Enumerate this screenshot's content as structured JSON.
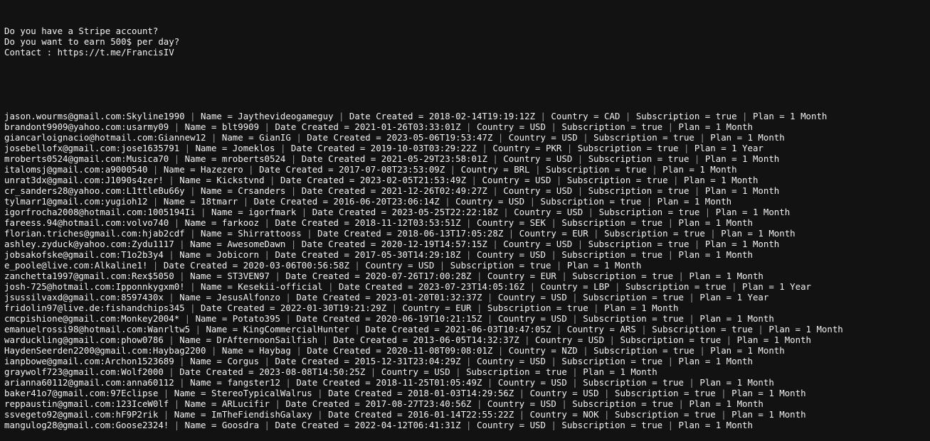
{
  "terminal": {
    "background_color": "#121212",
    "text_color": "#f2f2f2",
    "separator_color": "#9a9a9a",
    "banner": [
      "Do you have a Stripe account?",
      "Do you want to earn 500$ per day?",
      "Contact : https://t.me/FrancisIV"
    ],
    "field_labels": {
      "name": "Name",
      "date_created": "Date Created",
      "country": "Country",
      "subscription": "Subscription",
      "plan": "Plan"
    },
    "separator": "|",
    "equals": "=",
    "records": [
      {
        "credentials": "jason.wourms@gmail.com:Skyline1990",
        "name": "Jaythevideogameguy",
        "date_created": "2018-02-14T19:19:12Z",
        "country": "CAD",
        "subscription": "true",
        "plan": "1 Month"
      },
      {
        "credentials": "brandont9909@yahoo.com:usarmy09",
        "name": "blt9909",
        "date_created": "2021-01-26T03:33:01Z",
        "country": "USD",
        "subscription": "true",
        "plan": "1 Month"
      },
      {
        "credentials": "giancarloignacio@hotmail.com:Giannew12",
        "name": "GianIG",
        "date_created": "2023-05-06T19:53:47Z",
        "country": "USD",
        "subscription": "true",
        "plan": "1 Month"
      },
      {
        "credentials": "josebellofx@gmail.com:jose1635791",
        "name": "Jomeklos",
        "date_created": "2019-10-03T03:29:22Z",
        "country": "PKR",
        "subscription": "true",
        "plan": "1 Year"
      },
      {
        "credentials": "mroberts0524@gmail.com:Musica70",
        "name": "mroberts0524",
        "date_created": "2021-05-29T23:58:01Z",
        "country": "USD",
        "subscription": "true",
        "plan": "1 Month"
      },
      {
        "credentials": "italomsj@gmail.com:a9000540",
        "name": "Hazezero",
        "date_created": "2017-07-08T23:53:09Z",
        "country": "BRL",
        "subscription": "true",
        "plan": "1 Month"
      },
      {
        "credentials": "unrat3dx@gmail.com:J1090s4zer!",
        "name": "Kickstvnd",
        "date_created": "2023-02-05T21:53:49Z",
        "country": "USD",
        "subscription": "true",
        "plan": "1 Month"
      },
      {
        "credentials": "cr_sanders28@yahoo.com:L1ttleBu66y",
        "name": "Crsanders",
        "date_created": "2021-12-26T02:49:27Z",
        "country": "USD",
        "subscription": "true",
        "plan": "1 Month"
      },
      {
        "credentials": "tylmarr1@gmail.com:yugioh12",
        "name": "18tmarr",
        "date_created": "2016-06-20T23:06:14Z",
        "country": "USD",
        "subscription": "true",
        "plan": "1 Month"
      },
      {
        "credentials": "igorfrocha2008@hotmail.com:1005194Ii",
        "name": "igorfmark",
        "date_created": "2023-05-25T22:22:18Z",
        "country": "USD",
        "subscription": "true",
        "plan": "1 Month"
      },
      {
        "credentials": "fareess.94@hotmail.com:volvo740",
        "name": "farkooz",
        "date_created": "2018-11-12T03:53:51Z",
        "country": "SEK",
        "subscription": "true",
        "plan": "1 Month"
      },
      {
        "credentials": "florian.triches@gmail.com:hjab2cdf",
        "name": "Shirrattooss",
        "date_created": "2018-06-13T17:05:28Z",
        "country": "EUR",
        "subscription": "true",
        "plan": "1 Month"
      },
      {
        "credentials": "ashley.zyduck@yahoo.com:Zydu1117",
        "name": "AwesomeDawn",
        "date_created": "2020-12-19T14:57:15Z",
        "country": "USD",
        "subscription": "true",
        "plan": "1 Month"
      },
      {
        "credentials": "jobsakofske@gmail.com:T1o2b3y4",
        "name": "Jobicorn",
        "date_created": "2017-05-30T14:29:18Z",
        "country": "USD",
        "subscription": "true",
        "plan": "1 Month"
      },
      {
        "credentials": "e_poole@live.com:Alkaline1!",
        "name": null,
        "date_created": "2020-03-06T00:56:58Z",
        "country": "USD",
        "subscription": "true",
        "plan": "1 Month"
      },
      {
        "credentials": "zanchetta1997@gmail.com:Rex$5050",
        "name": "ST3VEN97",
        "date_created": "2020-07-26T17:00:28Z",
        "country": "EUR",
        "subscription": "true",
        "plan": "1 Month"
      },
      {
        "credentials": "josh-725@hotmail.com:Ipponnkygxm0!",
        "name": "Kesekii-official",
        "date_created": "2023-07-23T14:05:16Z",
        "country": "LBP",
        "subscription": "true",
        "plan": "1 Year"
      },
      {
        "credentials": "jsussilvaxd@gmail.com:8597430x",
        "name": "JesusAlfonzo",
        "date_created": "2023-01-20T01:32:37Z",
        "country": "USD",
        "subscription": "true",
        "plan": "1 Year"
      },
      {
        "credentials": "fridolin97@live.de:fishandchips345",
        "name": null,
        "date_created": "2022-01-30T19:21:29Z",
        "country": "EUR",
        "subscription": "true",
        "plan": "1 Month"
      },
      {
        "credentials": "cmcpishione@gmail.com:Monkey2004*",
        "name": "Potato395",
        "date_created": "2020-06-19T10:21:15Z",
        "country": "USD",
        "subscription": "true",
        "plan": "1 Month"
      },
      {
        "credentials": "emanuelrossi98@hotmail.com:Wanrltw5",
        "name": "KingCommercialHunter",
        "date_created": "2021-06-03T10:47:05Z",
        "country": "ARS",
        "subscription": "true",
        "plan": "1 Month"
      },
      {
        "credentials": "warduckling@gmail.com:phow0786",
        "name": "DrAfternoonSailfish",
        "date_created": "2013-06-05T14:32:37Z",
        "country": "USD",
        "subscription": "true",
        "plan": "1 Month"
      },
      {
        "credentials": "HaydenSeerden2200@gmail.com:Haybag2200",
        "name": "Haybag",
        "date_created": "2020-11-08T09:08:01Z",
        "country": "NZD",
        "subscription": "true",
        "plan": "1 Month"
      },
      {
        "credentials": "ianpbowe@gmail.com:Archon1523689",
        "name": "Corgus",
        "date_created": "2015-12-31T23:04:29Z",
        "country": "USD",
        "subscription": "true",
        "plan": "1 Month"
      },
      {
        "credentials": "graywolf723@gmail.com:Wolf2000",
        "name": null,
        "date_created": "2023-08-08T14:50:25Z",
        "country": "USD",
        "subscription": "true",
        "plan": "1 Month"
      },
      {
        "credentials": "arianna60112@gmail.com:anna60112",
        "name": "fangster12",
        "date_created": "2018-11-25T01:05:49Z",
        "country": "USD",
        "subscription": "true",
        "plan": "1 Month"
      },
      {
        "credentials": "baker41o7@gmail.com:97Eclipse",
        "name": "StereoTypicalWalrus",
        "date_created": "2018-01-03T14:29:56Z",
        "country": "USD",
        "subscription": "true",
        "plan": "1 Month"
      },
      {
        "credentials": "reppaustin@gmail.com:123IceW0lf",
        "name": "ARLucifir",
        "date_created": "2017-08-27T23:40:56Z",
        "country": "USD",
        "subscription": "true",
        "plan": "1 Month"
      },
      {
        "credentials": "ssvegeto92@gmail.com:hF9P2rik",
        "name": "ImTheFiendishGalaxy",
        "date_created": "2016-01-14T22:55:22Z",
        "country": "NOK",
        "subscription": "true",
        "plan": "1 Month"
      },
      {
        "credentials": "mangulog28@gmail.com:Goose2324!",
        "name": "Goosdra",
        "date_created": "2022-04-12T06:41:31Z",
        "country": "USD",
        "subscription": "true",
        "plan": "1 Month"
      }
    ]
  }
}
